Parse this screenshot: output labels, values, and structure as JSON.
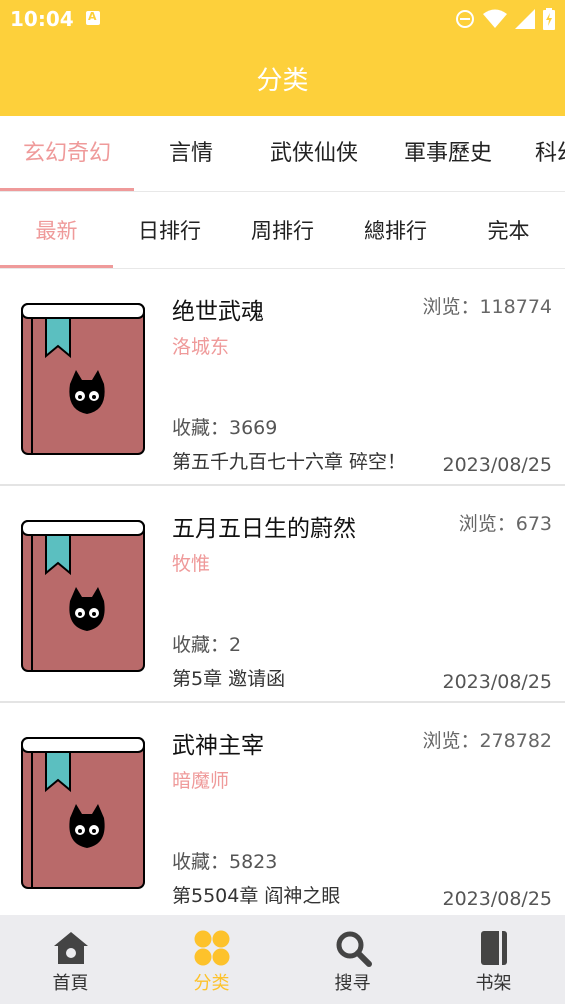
{
  "status_bar": {
    "time": "10:04",
    "notification_letter": "A"
  },
  "app_bar": {
    "title": "分类"
  },
  "category_tabs": [
    {
      "label": "玄幻奇幻",
      "active": true
    },
    {
      "label": "言情",
      "active": false
    },
    {
      "label": "武侠仙侠",
      "active": false
    },
    {
      "label": "軍事歷史",
      "active": false
    },
    {
      "label": "科幻",
      "active": false
    }
  ],
  "sort_tabs": [
    {
      "label": "最新",
      "active": true
    },
    {
      "label": "日排行",
      "active": false
    },
    {
      "label": "周排行",
      "active": false
    },
    {
      "label": "總排行",
      "active": false
    },
    {
      "label": "完本",
      "active": false
    }
  ],
  "books": [
    {
      "title": "绝世武魂",
      "author": "洛城东",
      "views": "浏览：118774",
      "favorites": "收藏：3669",
      "latest_chapter": "第五千九百七十六章 碎空！",
      "date": "2023/08/25"
    },
    {
      "title": "五月五日生的蔚然",
      "author": "牧惟",
      "views": "浏览：673",
      "favorites": "收藏：2",
      "latest_chapter": "第5章 邀请函",
      "date": "2023/08/25"
    },
    {
      "title": "武神主宰",
      "author": "暗魔师",
      "views": "浏览：278782",
      "favorites": "收藏：5823",
      "latest_chapter": "第5504章 阎神之眼",
      "date": "2023/08/25"
    }
  ],
  "bottom_nav": [
    {
      "label": "首頁",
      "icon": "home-icon",
      "active": false
    },
    {
      "label": "分类",
      "icon": "category-icon",
      "active": true
    },
    {
      "label": "搜寻",
      "icon": "search-icon",
      "active": false
    },
    {
      "label": "书架",
      "icon": "bookshelf-icon",
      "active": false
    }
  ],
  "colors": {
    "accent": "#fdd03b",
    "active_tab": "#ef9a9a",
    "nav_active": "#fdc22b",
    "cover": "#b96a6a",
    "bookmark": "#5bbfc0"
  }
}
